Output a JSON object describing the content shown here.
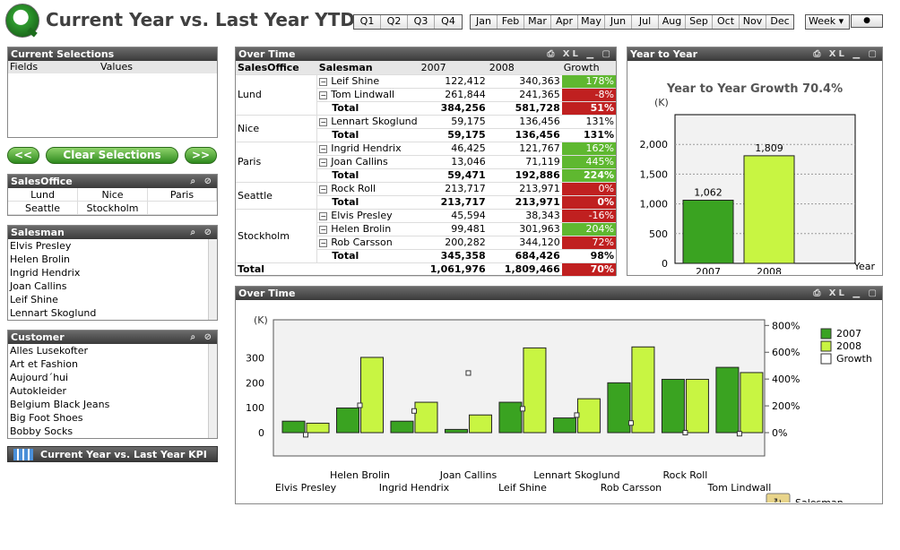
{
  "app": {
    "title": "Current Year vs. Last Year YTD"
  },
  "quarters": [
    "Q1",
    "Q2",
    "Q3",
    "Q4"
  ],
  "months": [
    "Jan",
    "Feb",
    "Mar",
    "Apr",
    "May",
    "Jun",
    "Jul",
    "Aug",
    "Sep",
    "Oct",
    "Nov",
    "Dec"
  ],
  "week_select": "Week",
  "current_selections": {
    "title": "Current Selections",
    "col_fields": "Fields",
    "col_values": "Values"
  },
  "nav": {
    "back": "<<",
    "clear": "Clear Selections",
    "forward": ">>"
  },
  "salesoffice": {
    "title": "SalesOffice",
    "items": [
      "Lund",
      "Nice",
      "Paris",
      "Seattle",
      "Stockholm"
    ]
  },
  "salesman_list": {
    "title": "Salesman",
    "items": [
      "Elvis Presley",
      "Helen Brolin",
      "Ingrid Hendrix",
      "Joan Callins",
      "Leif Shine",
      "Lennart Skoglund"
    ]
  },
  "customer_list": {
    "title": "Customer",
    "items": [
      "Alles Lusekofter",
      "Art et Fashion",
      "Aujourd´hui",
      "Autokleider",
      "Belgium Black Jeans",
      "Big Foot Shoes",
      "Bobby Socks"
    ]
  },
  "kpi_button": "Current Year vs. Last Year KPI",
  "over_time_table": {
    "title": "Over Time",
    "headers": [
      "SalesOffice",
      "Salesman",
      "2007",
      "2008",
      "Growth"
    ],
    "total_label": "Total",
    "offices": [
      {
        "name": "Lund",
        "rows": [
          [
            "Leif Shine",
            "122,412",
            "340,363",
            "178%",
            "up"
          ],
          [
            "Tom Lindwall",
            "261,844",
            "241,365",
            "-8%",
            "dn"
          ]
        ],
        "total": [
          "384,256",
          "581,728",
          "51%",
          "dn"
        ]
      },
      {
        "name": "Nice",
        "rows": [
          [
            "Lennart Skoglund",
            "59,175",
            "136,456",
            "131%",
            "nt"
          ]
        ],
        "total": [
          "59,175",
          "136,456",
          "131%",
          "nt"
        ]
      },
      {
        "name": "Paris",
        "rows": [
          [
            "Ingrid Hendrix",
            "46,425",
            "121,767",
            "162%",
            "up"
          ],
          [
            "Joan Callins",
            "13,046",
            "71,119",
            "445%",
            "up"
          ]
        ],
        "total": [
          "59,471",
          "192,886",
          "224%",
          "up"
        ]
      },
      {
        "name": "Seattle",
        "rows": [
          [
            "Rock Roll",
            "213,717",
            "213,971",
            "0%",
            "dn"
          ]
        ],
        "total": [
          "213,717",
          "213,971",
          "0%",
          "dn"
        ]
      },
      {
        "name": "Stockholm",
        "rows": [
          [
            "Elvis Presley",
            "45,594",
            "38,343",
            "-16%",
            "dn"
          ],
          [
            "Helen Brolin",
            "99,481",
            "301,963",
            "204%",
            "up"
          ],
          [
            "Rob Carsson",
            "200,282",
            "344,120",
            "72%",
            "dn"
          ]
        ],
        "total": [
          "345,358",
          "684,426",
          "98%",
          "nt"
        ]
      }
    ],
    "grand_total": [
      "Total",
      "1,061,976",
      "1,809,466",
      "70%"
    ]
  },
  "year_to_year": {
    "title": "Year to Year",
    "chart_title": "Year to Year Growth 70.4%",
    "unit": "(K)",
    "xlabel": "Year"
  },
  "over_time_chart": {
    "title": "Over Time",
    "unit": "(K)",
    "dim_label": "Salesman"
  },
  "colors": {
    "y2007": "#3aa321",
    "y2008": "#c8f542",
    "up": "#5fb830",
    "down": "#c02020"
  },
  "chart_data": [
    {
      "type": "bar",
      "title": "Year to Year Growth 70.4%",
      "categories": [
        "2007",
        "2008"
      ],
      "values": [
        1062,
        1809
      ],
      "data_labels": [
        "1,062",
        "1,809"
      ],
      "ylabel": "(K)",
      "xlabel": "Year",
      "ylim": [
        0,
        2500
      ],
      "yticks": [
        "0",
        "500",
        "1,000",
        "1,500",
        "2,000"
      ],
      "grid": true
    },
    {
      "type": "bar",
      "categories": [
        "Elvis Presley",
        "Helen Brolin",
        "Ingrid Hendrix",
        "Joan Callins",
        "Leif Shine",
        "Lennart Skoglund",
        "Rob Carsson",
        "Rock Roll",
        "Tom Lindwall"
      ],
      "series": [
        {
          "name": "2007",
          "values": [
            46,
            99,
            46,
            13,
            122,
            59,
            200,
            214,
            262
          ]
        },
        {
          "name": "2008",
          "values": [
            38,
            302,
            122,
            71,
            340,
            136,
            344,
            214,
            241
          ]
        },
        {
          "name": "Growth",
          "axis": "right",
          "values": [
            -16,
            204,
            162,
            445,
            178,
            131,
            72,
            0,
            -8
          ]
        }
      ],
      "ylabel": "(K)",
      "ylim": [
        -100,
        450
      ],
      "yticks": [
        "0",
        "100",
        "200",
        "300"
      ],
      "y2ticks": [
        "0%",
        "200%",
        "400%",
        "600%",
        "800%"
      ],
      "y2lim": [
        -200,
        900
      ],
      "legend": "top-right",
      "xlabel": "Salesman"
    }
  ]
}
